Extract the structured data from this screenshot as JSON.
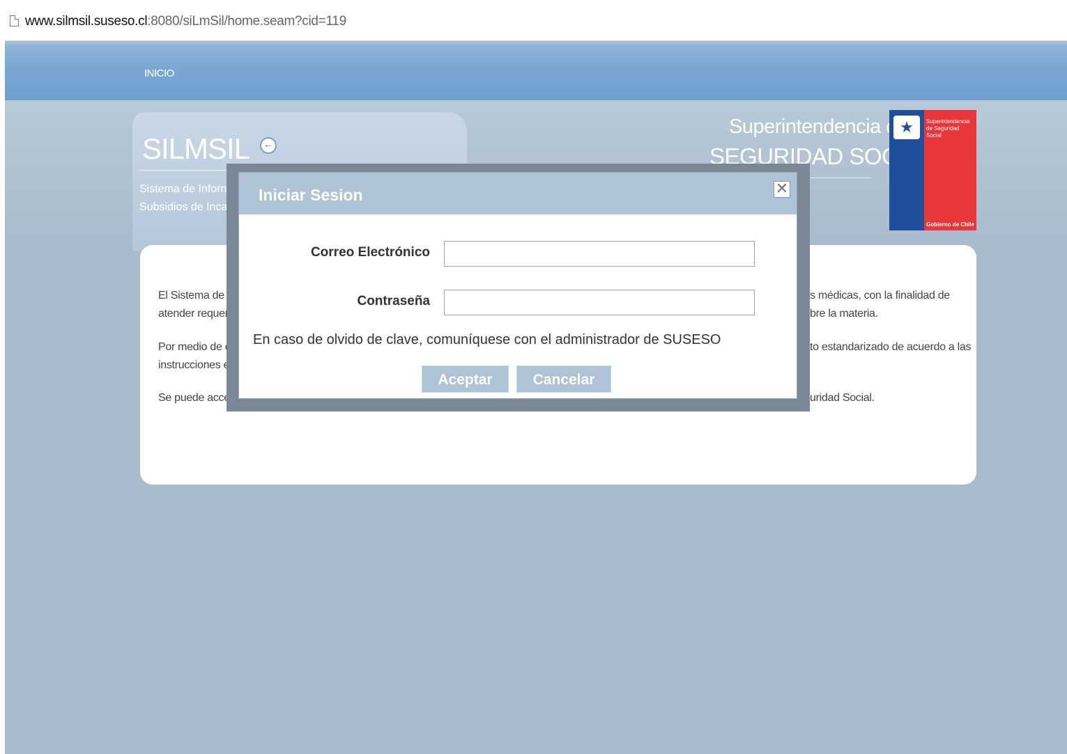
{
  "browser": {
    "url_host": "www.silmsil.suseso.cl",
    "url_path": ":8080/siLmSil/home.seam?cid=119"
  },
  "nav": {
    "items": [
      {
        "label": "INICIO"
      }
    ]
  },
  "header": {
    "app_title": "SILMSIL",
    "subtitle_line1": "Sistema de Inforn",
    "subtitle_line2": "Subsidios de Inca",
    "agency_line1": "Superintendencia de",
    "agency_line2": "SEGURIDAD SOCIAL",
    "logo": {
      "line1": "Superintendencia",
      "line2": "de Seguridad",
      "line3": "Social",
      "footer": "Gobierno de Chile"
    }
  },
  "content": {
    "p1_left_a": "El Sistema de In",
    "p1_left_b": "atender requerin",
    "p1_right_a": "s médicas, con la finalidad de",
    "p1_right_b": "bre la materia.",
    "p2_left_a": "Por medio de es",
    "p2_left_b": "instrucciones es",
    "p2_right_a": "to estandarizado de acuerdo a las",
    "p3_left": "Se puede acced",
    "p3_right": "uridad Social."
  },
  "login_dialog": {
    "title": "Iniciar Sesion",
    "close_symbol": "✕",
    "email_label": "Correo Electrónico",
    "email_value": "",
    "password_label": "Contraseña",
    "password_value": "",
    "note": "En caso de olvido de clave, comuníquese con el administrador de SUSESO",
    "accept_label": "Aceptar",
    "cancel_label": "Cancelar"
  },
  "colors": {
    "page_bg": "#a9bccd",
    "nav_bg": "#7aa7d3",
    "dialog_header": "#aec3d6",
    "logo_blue": "#1f4e9b",
    "logo_red": "#e8363a"
  }
}
